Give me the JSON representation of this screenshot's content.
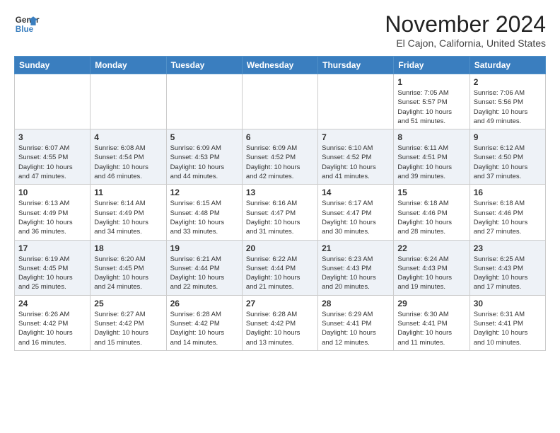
{
  "header": {
    "logo_line1": "General",
    "logo_line2": "Blue",
    "month": "November 2024",
    "location": "El Cajon, California, United States"
  },
  "weekdays": [
    "Sunday",
    "Monday",
    "Tuesday",
    "Wednesday",
    "Thursday",
    "Friday",
    "Saturday"
  ],
  "weeks": [
    [
      {
        "day": "",
        "info": ""
      },
      {
        "day": "",
        "info": ""
      },
      {
        "day": "",
        "info": ""
      },
      {
        "day": "",
        "info": ""
      },
      {
        "day": "",
        "info": ""
      },
      {
        "day": "1",
        "info": "Sunrise: 7:05 AM\nSunset: 5:57 PM\nDaylight: 10 hours\nand 51 minutes."
      },
      {
        "day": "2",
        "info": "Sunrise: 7:06 AM\nSunset: 5:56 PM\nDaylight: 10 hours\nand 49 minutes."
      }
    ],
    [
      {
        "day": "3",
        "info": "Sunrise: 6:07 AM\nSunset: 4:55 PM\nDaylight: 10 hours\nand 47 minutes."
      },
      {
        "day": "4",
        "info": "Sunrise: 6:08 AM\nSunset: 4:54 PM\nDaylight: 10 hours\nand 46 minutes."
      },
      {
        "day": "5",
        "info": "Sunrise: 6:09 AM\nSunset: 4:53 PM\nDaylight: 10 hours\nand 44 minutes."
      },
      {
        "day": "6",
        "info": "Sunrise: 6:09 AM\nSunset: 4:52 PM\nDaylight: 10 hours\nand 42 minutes."
      },
      {
        "day": "7",
        "info": "Sunrise: 6:10 AM\nSunset: 4:52 PM\nDaylight: 10 hours\nand 41 minutes."
      },
      {
        "day": "8",
        "info": "Sunrise: 6:11 AM\nSunset: 4:51 PM\nDaylight: 10 hours\nand 39 minutes."
      },
      {
        "day": "9",
        "info": "Sunrise: 6:12 AM\nSunset: 4:50 PM\nDaylight: 10 hours\nand 37 minutes."
      }
    ],
    [
      {
        "day": "10",
        "info": "Sunrise: 6:13 AM\nSunset: 4:49 PM\nDaylight: 10 hours\nand 36 minutes."
      },
      {
        "day": "11",
        "info": "Sunrise: 6:14 AM\nSunset: 4:49 PM\nDaylight: 10 hours\nand 34 minutes."
      },
      {
        "day": "12",
        "info": "Sunrise: 6:15 AM\nSunset: 4:48 PM\nDaylight: 10 hours\nand 33 minutes."
      },
      {
        "day": "13",
        "info": "Sunrise: 6:16 AM\nSunset: 4:47 PM\nDaylight: 10 hours\nand 31 minutes."
      },
      {
        "day": "14",
        "info": "Sunrise: 6:17 AM\nSunset: 4:47 PM\nDaylight: 10 hours\nand 30 minutes."
      },
      {
        "day": "15",
        "info": "Sunrise: 6:18 AM\nSunset: 4:46 PM\nDaylight: 10 hours\nand 28 minutes."
      },
      {
        "day": "16",
        "info": "Sunrise: 6:18 AM\nSunset: 4:46 PM\nDaylight: 10 hours\nand 27 minutes."
      }
    ],
    [
      {
        "day": "17",
        "info": "Sunrise: 6:19 AM\nSunset: 4:45 PM\nDaylight: 10 hours\nand 25 minutes."
      },
      {
        "day": "18",
        "info": "Sunrise: 6:20 AM\nSunset: 4:45 PM\nDaylight: 10 hours\nand 24 minutes."
      },
      {
        "day": "19",
        "info": "Sunrise: 6:21 AM\nSunset: 4:44 PM\nDaylight: 10 hours\nand 22 minutes."
      },
      {
        "day": "20",
        "info": "Sunrise: 6:22 AM\nSunset: 4:44 PM\nDaylight: 10 hours\nand 21 minutes."
      },
      {
        "day": "21",
        "info": "Sunrise: 6:23 AM\nSunset: 4:43 PM\nDaylight: 10 hours\nand 20 minutes."
      },
      {
        "day": "22",
        "info": "Sunrise: 6:24 AM\nSunset: 4:43 PM\nDaylight: 10 hours\nand 19 minutes."
      },
      {
        "day": "23",
        "info": "Sunrise: 6:25 AM\nSunset: 4:43 PM\nDaylight: 10 hours\nand 17 minutes."
      }
    ],
    [
      {
        "day": "24",
        "info": "Sunrise: 6:26 AM\nSunset: 4:42 PM\nDaylight: 10 hours\nand 16 minutes."
      },
      {
        "day": "25",
        "info": "Sunrise: 6:27 AM\nSunset: 4:42 PM\nDaylight: 10 hours\nand 15 minutes."
      },
      {
        "day": "26",
        "info": "Sunrise: 6:28 AM\nSunset: 4:42 PM\nDaylight: 10 hours\nand 14 minutes."
      },
      {
        "day": "27",
        "info": "Sunrise: 6:28 AM\nSunset: 4:42 PM\nDaylight: 10 hours\nand 13 minutes."
      },
      {
        "day": "28",
        "info": "Sunrise: 6:29 AM\nSunset: 4:41 PM\nDaylight: 10 hours\nand 12 minutes."
      },
      {
        "day": "29",
        "info": "Sunrise: 6:30 AM\nSunset: 4:41 PM\nDaylight: 10 hours\nand 11 minutes."
      },
      {
        "day": "30",
        "info": "Sunrise: 6:31 AM\nSunset: 4:41 PM\nDaylight: 10 hours\nand 10 minutes."
      }
    ]
  ]
}
